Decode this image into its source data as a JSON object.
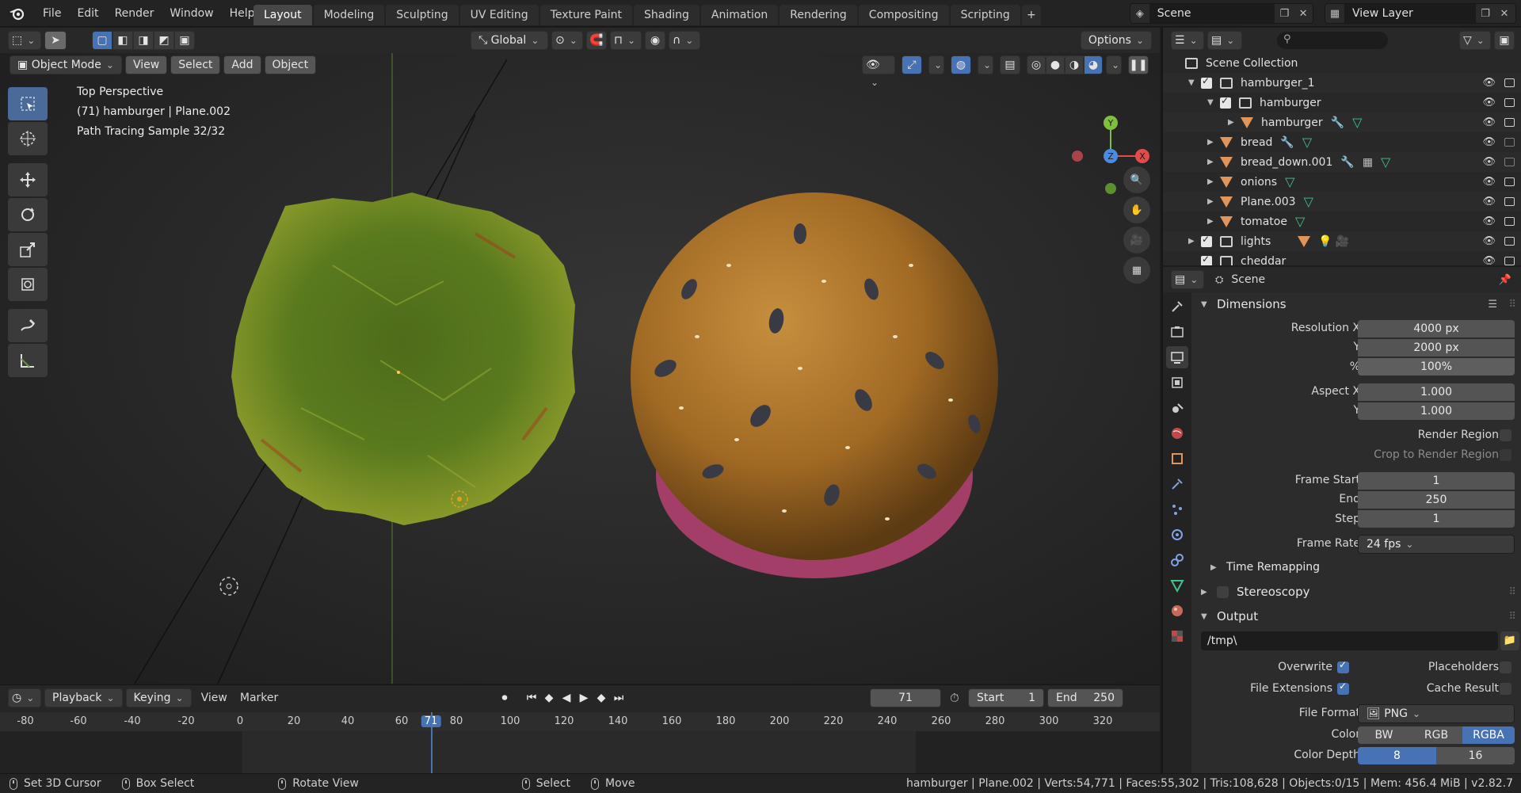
{
  "menu": [
    "File",
    "Edit",
    "Render",
    "Window",
    "Help"
  ],
  "workspace_tabs": [
    "Layout",
    "Modeling",
    "Sculpting",
    "UV Editing",
    "Texture Paint",
    "Shading",
    "Animation",
    "Rendering",
    "Compositing",
    "Scripting"
  ],
  "active_workspace": "Layout",
  "scene_name": "Scene",
  "view_layer": "View Layer",
  "viewport": {
    "transform_orientation": "Global",
    "options_label": "Options",
    "mode": "Object Mode",
    "menus": [
      "View",
      "Select",
      "Add",
      "Object"
    ],
    "overlay_lines": [
      "Top Perspective",
      "(71) hamburger | Plane.002",
      "Path Tracing Sample 32/32"
    ],
    "gizmo": {
      "x": "X",
      "y": "Y",
      "z": "Z"
    }
  },
  "timeline": {
    "menus": [
      "Playback",
      "Keying",
      "View",
      "Marker"
    ],
    "current_frame": "71",
    "start_label": "Start",
    "start_value": "1",
    "end_label": "End",
    "end_value": "250",
    "ticks": [
      "-80",
      "-60",
      "-40",
      "-20",
      "0",
      "20",
      "40",
      "60",
      "71",
      "80",
      "100",
      "120",
      "140",
      "160",
      "180",
      "200",
      "220",
      "240",
      "260",
      "280",
      "300",
      "320"
    ]
  },
  "statusbar": {
    "hints": [
      "Set 3D Cursor",
      "Box Select",
      "Rotate View",
      "Select",
      "Move"
    ],
    "info": "hamburger | Plane.002 | Verts:54,771 | Faces:55,302 | Tris:108,628 | Objects:0/15 | Mem: 456.4 MiB | v2.82.7"
  },
  "outliner": {
    "root": "Scene Collection",
    "rows": [
      {
        "name": "hamburger_1",
        "kind": "collection"
      },
      {
        "name": "hamburger",
        "kind": "collection"
      },
      {
        "name": "hamburger",
        "kind": "mesh"
      },
      {
        "name": "bread",
        "kind": "mesh"
      },
      {
        "name": "bread_down.001",
        "kind": "mesh"
      },
      {
        "name": "onions",
        "kind": "mesh"
      },
      {
        "name": "Plane.003",
        "kind": "mesh"
      },
      {
        "name": "tomatoe",
        "kind": "mesh"
      },
      {
        "name": "lights",
        "kind": "collection"
      },
      {
        "name": "cheddar",
        "kind": "collection"
      }
    ]
  },
  "properties": {
    "context": "Scene",
    "dimensions": {
      "title": "Dimensions",
      "res_x_label": "Resolution X",
      "res_x": "4000 px",
      "res_y_label": "Y",
      "res_y": "2000 px",
      "pct_label": "%",
      "pct": "100%",
      "aspect_x_label": "Aspect X",
      "aspect_x": "1.000",
      "aspect_y_label": "Y",
      "aspect_y": "1.000",
      "render_region": "Render Region",
      "crop_region": "Crop to Render Region",
      "frame_start_label": "Frame Start",
      "frame_start": "1",
      "end_label": "End",
      "end": "250",
      "step_label": "Step",
      "step": "1",
      "frame_rate_label": "Frame Rate",
      "frame_rate": "24 fps",
      "time_remapping": "Time Remapping"
    },
    "stereoscopy": "Stereoscopy",
    "output": {
      "title": "Output",
      "path": "/tmp\\",
      "overwrite": "Overwrite",
      "placeholders": "Placeholders",
      "file_extensions": "File Extensions",
      "cache_result": "Cache Result",
      "file_format_label": "File Format",
      "file_format": "PNG",
      "color_label": "Color",
      "color_options": [
        "BW",
        "RGB",
        "RGBA"
      ],
      "color_selected": "RGBA",
      "color_depth_label": "Color Depth",
      "color_depth_options": [
        "8",
        "16"
      ]
    }
  }
}
